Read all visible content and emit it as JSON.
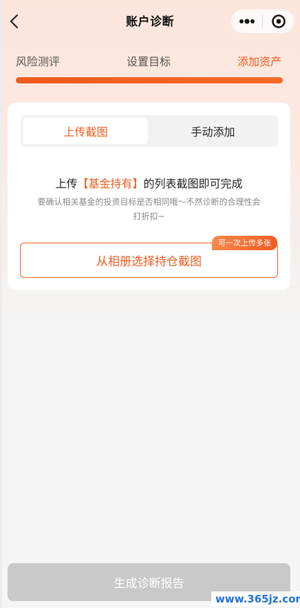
{
  "header": {
    "title": "账户诊断",
    "back_icon": "chevron-left-icon",
    "more_icon": "more-dots-icon",
    "close_icon": "target-circle-icon"
  },
  "steps": {
    "items": [
      "风险测评",
      "设置目标",
      "添加资产"
    ],
    "active_index": 2,
    "progress_percent": 100
  },
  "card": {
    "tabs": [
      "上传截图",
      "手动添加"
    ],
    "active_tab": 0,
    "headline_prefix": "上传",
    "headline_highlight": "【基金持有】",
    "headline_suffix": "的列表截图即可完成",
    "subtext": "要确认相关基金的投资目标是否相同哦～不然诊断的合理性会打折扣~",
    "select_button": "从相册选择持仓截图",
    "badge": "可一次上传多张"
  },
  "footer": {
    "generate_button": "生成诊断报告"
  },
  "watermark": "www.365jz.com",
  "colors": {
    "accent": "#f35a1e",
    "disabled": "#c9c9c9"
  }
}
